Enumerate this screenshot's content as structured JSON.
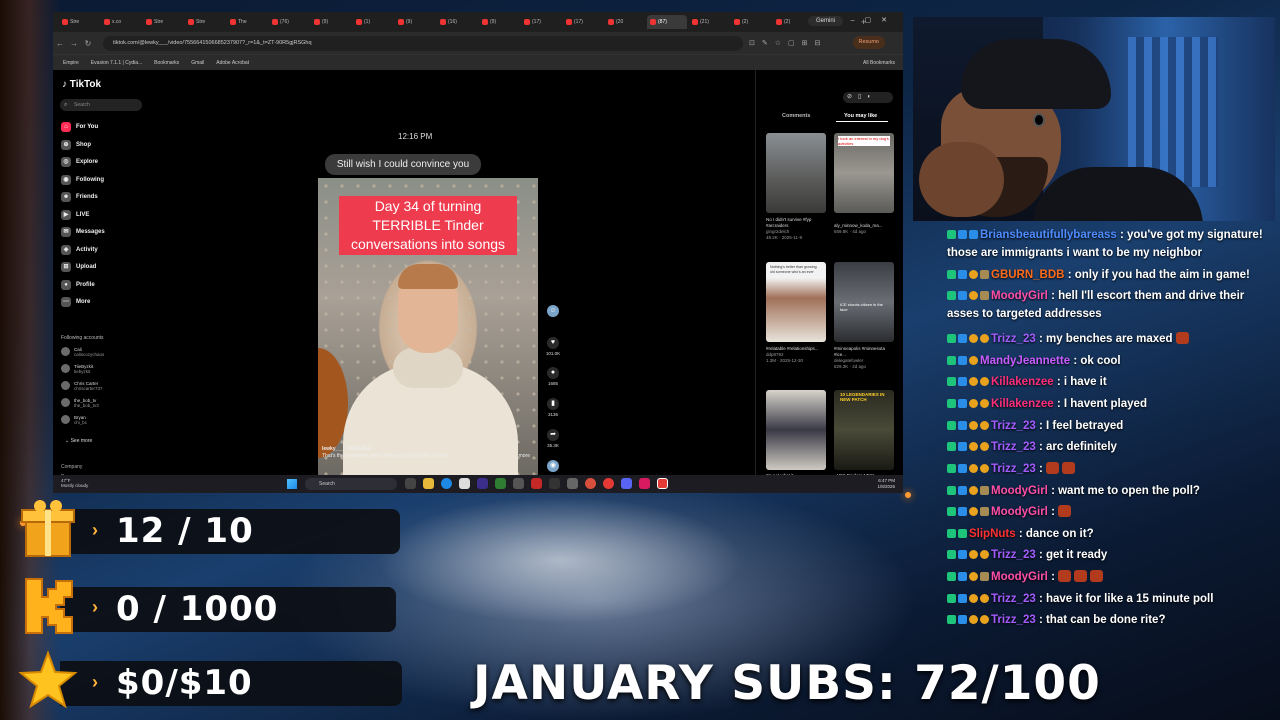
{
  "browser": {
    "tabs": [
      "Stre",
      "x.co",
      "Stre",
      "Stre",
      "The",
      "(76)",
      "(9)",
      "(1)",
      "(9)",
      "(16)",
      "(9)",
      "(17)",
      "(17)",
      "(20",
      "(87)",
      "(21)",
      "(2)",
      "(2)",
      "(4)"
    ],
    "gemini_label": "Gemini",
    "url": "tiktok.com/@lewky___/video/7556641506685237907?_r=1&_t=ZT-90R5gjRSGhq",
    "resume_label": "Resumo",
    "bookmarks": [
      "Empire",
      "Evasion 7.1.1 | Cydia...",
      "Bookmarks",
      "Gmail",
      "Adobe Acrobat"
    ],
    "all_bookmarks": "All Bookmarks"
  },
  "tiktok": {
    "logo": "TikTok",
    "search_placeholder": "Search",
    "nav": [
      "For You",
      "Shop",
      "Explore",
      "Following",
      "Friends",
      "LIVE",
      "Messages",
      "Activity",
      "Upload",
      "Profile",
      "More"
    ],
    "following_title": "Following accounts",
    "accounts": [
      {
        "name": "Cali",
        "handle": "caliscozychaos"
      },
      {
        "name": "TiieByzkit",
        "handle": "tiebyzkit"
      },
      {
        "name": "Chris Carter",
        "handle": "chriscarter737"
      },
      {
        "name": "the_bob_tv",
        "handle": "the_bob_tv3"
      },
      {
        "name": "Bryan",
        "handle": "chi_bc"
      }
    ],
    "see_more": "See more",
    "footer": [
      "Company",
      "Program"
    ],
    "timestamp": "12:16 PM",
    "bubble": "Still wish I could convince you",
    "caption": "Day 34 of turning TERRIBLE Tinder conversations into songs",
    "author": "lewky___ · 2025-10-2",
    "description": "That's the Halloween spirit! #lewysong #datingfile #tinder ...",
    "more": "more",
    "actions": [
      {
        "name": "like",
        "count": "101.0K"
      },
      {
        "name": "comment",
        "count": "1685"
      },
      {
        "name": "save",
        "count": "3136"
      },
      {
        "name": "share",
        "count": "35.3K"
      }
    ],
    "right_tabs": {
      "comments": "Comments",
      "you_may_like": "You may like"
    },
    "suggestions": [
      {
        "title": "No I didn't survive #fyp #arcraiders",
        "user": "gingr2delch",
        "meta": "48.2K · 2025-11-9"
      },
      {
        "title": "aly_minnow_koda_ma...",
        "user": "",
        "meta": "659.8K · 4d ago"
      },
      {
        "title": "#relatable #relationships...",
        "user": "ddp8792",
        "meta": "1.3M · 2025-12-30"
      },
      {
        "title": "#minneapolis #minnesota #ice...",
        "user": "delegatefowler",
        "meta": "829.3K · 2d ago"
      },
      {
        "title": "It's not what it",
        "user": "",
        "meta": ""
      },
      {
        "title": "ARC Raiders NEW",
        "user": "",
        "meta": ""
      }
    ],
    "thumb_text": [
      "I took an interest in my dog's activities",
      "Nothing's better than growing old someone who's an ever",
      "ICE shoots citizen in the face",
      "10 LEGENDARIES IN NEW PATCH"
    ]
  },
  "taskbar": {
    "weather_temp": "47°F",
    "weather_desc": "Mostly cloudy",
    "search": "Search",
    "time": "6:47 PM",
    "date": "1/8/2026"
  },
  "chat": [
    {
      "user": "Briansbeautifullybareass",
      "color": "#4f8cff",
      "text": ": you've got my signature! those are immigrants i want to be my neighbor",
      "badges": [
        "b1",
        "b2",
        "b2"
      ]
    },
    {
      "user": "GBURN_BDB",
      "color": "#ff6b1a",
      "text": ": only if you had the aim in game!",
      "badges": [
        "b1",
        "b2",
        "b3",
        "b4"
      ]
    },
    {
      "user": "MoodyGirl",
      "color": "#ff4fa8",
      "text": ": hell I'll escort them and drive their asses to targeted addresses",
      "badges": [
        "b1",
        "b2",
        "b3",
        "b4"
      ]
    },
    {
      "user": "Trizz_23",
      "color": "#a45cff",
      "text": ": my benches are maxed",
      "badges": [
        "b1",
        "b2",
        "b3",
        "b3"
      ],
      "emote": 1
    },
    {
      "user": "MandyJeannette",
      "color": "#c85cff",
      "text": ": ok cool",
      "badges": [
        "b1",
        "b2",
        "b3"
      ]
    },
    {
      "user": "Killakenzee",
      "color": "#ff2e7a",
      "text": ": i have it",
      "badges": [
        "b1",
        "b2",
        "b3",
        "b3"
      ]
    },
    {
      "user": "Killakenzee",
      "color": "#ff2e7a",
      "text": ": I havent played",
      "badges": [
        "b1",
        "b2",
        "b3",
        "b3"
      ]
    },
    {
      "user": "Trizz_23",
      "color": "#a45cff",
      "text": ": I feel betrayed",
      "badges": [
        "b1",
        "b2",
        "b3",
        "b3"
      ]
    },
    {
      "user": "Trizz_23",
      "color": "#a45cff",
      "text": ": arc definitely",
      "badges": [
        "b1",
        "b2",
        "b3",
        "b3"
      ]
    },
    {
      "user": "Trizz_23",
      "color": "#a45cff",
      "text": ":",
      "badges": [
        "b1",
        "b2",
        "b3",
        "b3"
      ],
      "emote": 2
    },
    {
      "user": "MoodyGirl",
      "color": "#ff4fa8",
      "text": ": want me to open the poll?",
      "badges": [
        "b1",
        "b2",
        "b3",
        "b4"
      ]
    },
    {
      "user": "MoodyGirl",
      "color": "#ff4fa8",
      "text": ":",
      "badges": [
        "b1",
        "b2",
        "b3",
        "b4"
      ],
      "emote": 1
    },
    {
      "user": "SlipNuts",
      "color": "#ff3030",
      "text": ": dance on it?",
      "badges": [
        "b1",
        "b1"
      ]
    },
    {
      "user": "Trizz_23",
      "color": "#a45cff",
      "text": ": get it ready",
      "badges": [
        "b1",
        "b2",
        "b3",
        "b3"
      ]
    },
    {
      "user": "MoodyGirl",
      "color": "#ff4fa8",
      "text": ":",
      "badges": [
        "b1",
        "b2",
        "b3",
        "b4"
      ],
      "emote": 3
    },
    {
      "user": "Trizz_23",
      "color": "#a45cff",
      "text": ": have it for like a 15 minute poll",
      "badges": [
        "b1",
        "b2",
        "b3",
        "b3"
      ]
    },
    {
      "user": "Trizz_23",
      "color": "#a45cff",
      "text": ": that can be done rite?",
      "badges": [
        "b1",
        "b2",
        "b3",
        "b3"
      ]
    }
  ],
  "goals": [
    {
      "icon": "gift-icon",
      "value": "12 / 10"
    },
    {
      "icon": "kick-logo-icon",
      "value": "0 / 1000"
    },
    {
      "icon": "star-icon",
      "value": "$0/$10"
    }
  ],
  "subs_goal": "JANUARY SUBS: 72/100"
}
